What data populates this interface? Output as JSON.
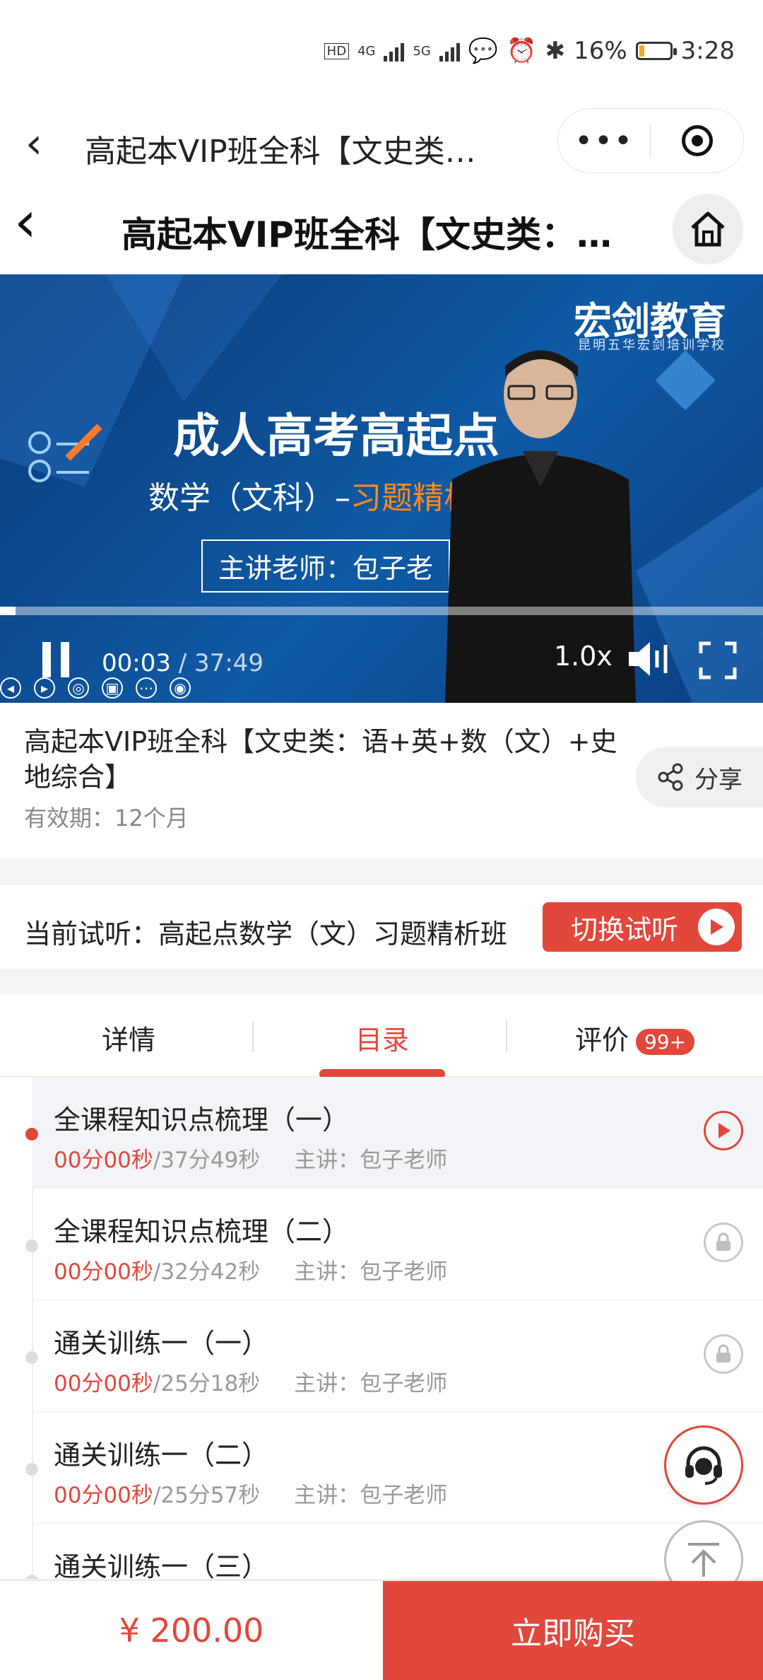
{
  "status_bar": {
    "network_hd": "HD",
    "net1": "4G",
    "net2": "5G",
    "battery_percent": "16%",
    "battery_level": 0.16,
    "time": "3:28"
  },
  "mini_program": {
    "title": "高起本VIP班全科【文史类…",
    "more_label": "•••"
  },
  "header": {
    "title": "高起本VIP班全科【文史类：…"
  },
  "video": {
    "logo": "宏剑教育",
    "logo_sub": "昆明五华宏剑培训学校",
    "headline": "成人高考高起点",
    "subline_prefix": "数学（文科）–",
    "subline_highlight": "习题精析",
    "teacher": "主讲老师：包子老",
    "current_time": "00:03",
    "total_time": " / 37:49",
    "progress": 0.002,
    "speed": "1.0x"
  },
  "course": {
    "title": "高起本VIP班全科【文史类：语+英+数（文）+史地综合】",
    "validity": "有效期：12个月",
    "share_label": "分享"
  },
  "trial": {
    "label": "当前试听：高起点数学（文）习题精析班",
    "switch_label": "切换试听"
  },
  "tabs": [
    {
      "label": "详情"
    },
    {
      "label": "目录"
    },
    {
      "label": "评价",
      "badge": "99+"
    }
  ],
  "lessons": [
    {
      "title": "全课程知识点梳理（一）",
      "watched": "00分00秒",
      "duration": "/37分49秒",
      "teacher": "主讲：包子老师",
      "state": "playing"
    },
    {
      "title": "全课程知识点梳理（二）",
      "watched": "00分00秒",
      "duration": "/32分42秒",
      "teacher": "主讲：包子老师",
      "state": "locked"
    },
    {
      "title": "通关训练一（一）",
      "watched": "00分00秒",
      "duration": "/25分18秒",
      "teacher": "主讲：包子老师",
      "state": "locked"
    },
    {
      "title": "通关训练一（二）",
      "watched": "00分00秒",
      "duration": "/25分57秒",
      "teacher": "主讲：包子老师",
      "state": "locked"
    },
    {
      "title": "通关训练一（三）",
      "watched": "",
      "duration": "",
      "teacher": "",
      "state": "locked"
    }
  ],
  "footer": {
    "price": "¥ 200.00",
    "buy_label": "立即购买"
  },
  "colors": {
    "accent": "#e2473b",
    "video_bg": "#0f5aa5"
  }
}
